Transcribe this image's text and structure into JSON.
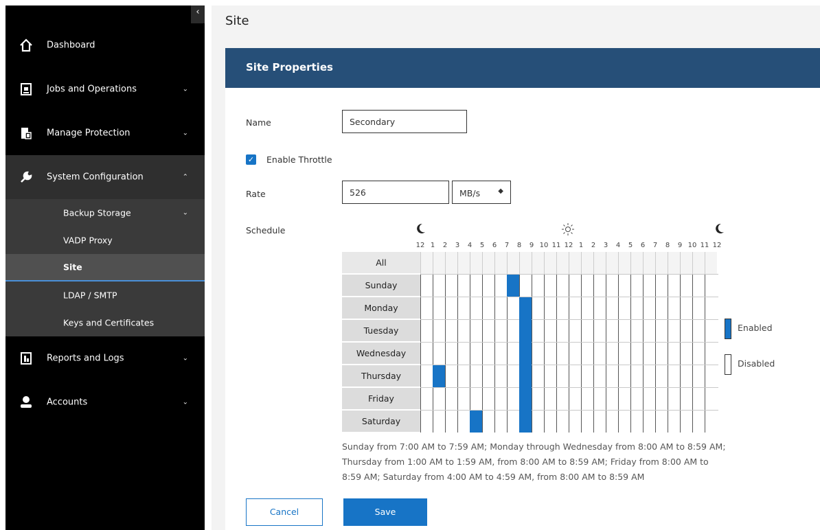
{
  "sidebar": {
    "collapse_icon": "chevron-left-icon",
    "items": [
      {
        "label": "Dashboard",
        "icon": "home-icon",
        "chevron": ""
      },
      {
        "label": "Jobs and Operations",
        "icon": "jobs-icon",
        "chevron": "⌄"
      },
      {
        "label": "Manage Protection",
        "icon": "protection-icon",
        "chevron": "⌄"
      },
      {
        "label": "System Configuration",
        "icon": "wrench-icon",
        "chevron": "⌃"
      },
      {
        "label": "Reports and Logs",
        "icon": "reports-icon",
        "chevron": "⌄"
      },
      {
        "label": "Accounts",
        "icon": "user-icon",
        "chevron": "⌄"
      }
    ],
    "subitems": [
      {
        "label": "Backup Storage",
        "chevron": "⌄"
      },
      {
        "label": "VADP Proxy",
        "chevron": ""
      },
      {
        "label": "Site",
        "chevron": ""
      },
      {
        "label": "LDAP / SMTP",
        "chevron": ""
      },
      {
        "label": "Keys and Certificates",
        "chevron": ""
      }
    ]
  },
  "page": {
    "title": "Site"
  },
  "panel": {
    "title": "Site Properties"
  },
  "form": {
    "name_label": "Name",
    "name_value": "Secondary",
    "throttle_label": "Enable Throttle",
    "throttle_checked": true,
    "rate_label": "Rate",
    "rate_value": "526",
    "rate_unit": "MB/s",
    "schedule_label": "Schedule"
  },
  "schedule": {
    "hour_labels": [
      "12",
      "1",
      "2",
      "3",
      "4",
      "5",
      "6",
      "7",
      "8",
      "9",
      "10",
      "11",
      "12",
      "1",
      "2",
      "3",
      "4",
      "5",
      "6",
      "7",
      "8",
      "9",
      "10",
      "11",
      "12"
    ],
    "icons": [
      "moon-icon",
      "sun-icon",
      "moon-icon"
    ],
    "all_label": "All",
    "days": [
      {
        "name": "Sunday",
        "enabled_hours": [
          7
        ]
      },
      {
        "name": "Monday",
        "enabled_hours": [
          8
        ]
      },
      {
        "name": "Tuesday",
        "enabled_hours": [
          8
        ]
      },
      {
        "name": "Wednesday",
        "enabled_hours": [
          8
        ]
      },
      {
        "name": "Thursday",
        "enabled_hours": [
          1,
          8
        ]
      },
      {
        "name": "Friday",
        "enabled_hours": [
          8
        ]
      },
      {
        "name": "Saturday",
        "enabled_hours": [
          4,
          8
        ]
      }
    ],
    "legend_enabled": "Enabled",
    "legend_disabled": "Disabled",
    "enabled_color": "#1774c6",
    "summary": "Sunday from 7:00 AM to 7:59 AM; Monday through Wednesday from 8:00 AM to 8:59 AM; Thursday from 1:00 AM to 1:59 AM, from 8:00 AM to 8:59 AM; Friday from 8:00 AM to 8:59 AM; Saturday from 4:00 AM to 4:59 AM, from 8:00 AM to 8:59 AM"
  },
  "buttons": {
    "cancel": "Cancel",
    "save": "Save"
  }
}
